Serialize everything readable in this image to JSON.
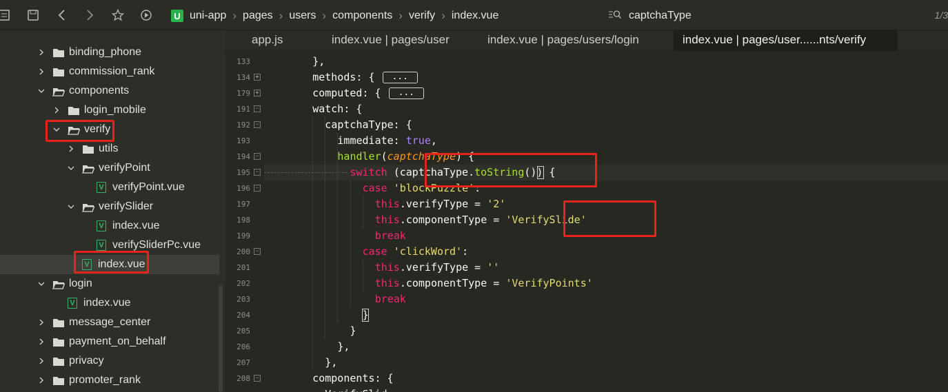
{
  "toolbar": {
    "icons": [
      "outline-icon",
      "save-icon",
      "back-icon",
      "forward-icon",
      "star-icon",
      "run-icon"
    ]
  },
  "address": {
    "logo": "U",
    "crumbs": [
      "uni-app",
      "pages",
      "users",
      "components",
      "verify",
      "index.vue"
    ]
  },
  "search": {
    "value": "captchaType"
  },
  "pager": "1/3",
  "tabs": [
    "app.js",
    "index.vue | pages/user",
    "index.vue | pages/users/login",
    "index.vue | pages/user......nts/verify"
  ],
  "tree": [
    {
      "label": "binding_phone",
      "type": "folder",
      "state": "closed"
    },
    {
      "label": "commission_rank",
      "type": "folder",
      "state": "closed"
    },
    {
      "label": "components",
      "type": "folder",
      "state": "open"
    },
    {
      "label": "login_mobile",
      "type": "folder",
      "state": "closed"
    },
    {
      "label": "verify",
      "type": "folder",
      "state": "open"
    },
    {
      "label": "utils",
      "type": "folder",
      "state": "closed"
    },
    {
      "label": "verifyPoint",
      "type": "folder",
      "state": "open"
    },
    {
      "label": "verifyPoint.vue",
      "type": "file"
    },
    {
      "label": "verifySlider",
      "type": "folder",
      "state": "open"
    },
    {
      "label": "index.vue",
      "type": "file"
    },
    {
      "label": "verifySliderPc.vue",
      "type": "file"
    },
    {
      "label": "index.vue",
      "type": "file"
    },
    {
      "label": "login",
      "type": "folder",
      "state": "open"
    },
    {
      "label": "index.vue",
      "type": "file"
    },
    {
      "label": "message_center",
      "type": "folder",
      "state": "closed"
    },
    {
      "label": "payment_on_behalf",
      "type": "folder",
      "state": "closed"
    },
    {
      "label": "privacy",
      "type": "folder",
      "state": "closed"
    },
    {
      "label": "promoter_rank",
      "type": "folder",
      "state": "closed"
    }
  ],
  "code": {
    "line_numbers": [
      "133",
      "134",
      "179",
      "191",
      "192",
      "193",
      "194",
      "195",
      "196",
      "197",
      "198",
      "199",
      "200",
      "201",
      "202",
      "203",
      "204",
      "205",
      "206",
      "207",
      "208"
    ],
    "fold_markers": [
      "",
      "+",
      "+",
      "-",
      "-",
      "",
      "-",
      "-",
      "-",
      "",
      "",
      "",
      "-",
      "",
      "",
      "",
      "",
      "",
      "",
      "",
      "-"
    ],
    "lines": [
      [
        {
          "t": "},",
          "c": "w"
        }
      ],
      [
        {
          "t": "methods: { ",
          "c": "w"
        },
        {
          "t": "...",
          "c": "fbox"
        }
      ],
      [
        {
          "t": "computed: { ",
          "c": "w"
        },
        {
          "t": "...",
          "c": "fbox"
        }
      ],
      [
        {
          "t": "watch: {",
          "c": "w"
        }
      ],
      [
        {
          "t": "captchaType: {",
          "c": "w"
        }
      ],
      [
        {
          "t": "immediate: ",
          "c": "w"
        },
        {
          "t": "true",
          "c": "p"
        },
        {
          "t": ",",
          "c": "w"
        }
      ],
      [
        {
          "t": "handler",
          "c": "f"
        },
        {
          "t": "(",
          "c": "w"
        },
        {
          "t": "captchaType",
          "c": "it"
        },
        {
          "t": ") {",
          "c": "w"
        }
      ],
      [
        {
          "t": "switch",
          "c": "k"
        },
        {
          "t": " (captchaType.",
          "c": "w"
        },
        {
          "t": "toString",
          "c": "f"
        },
        {
          "t": "()) {",
          "c": "w"
        }
      ],
      [
        {
          "t": "case",
          "c": "k"
        },
        {
          "t": " ",
          "c": "w"
        },
        {
          "t": "'blockPuzzle'",
          "c": "s"
        },
        {
          "t": ":",
          "c": "w"
        }
      ],
      [
        {
          "t": "this",
          "c": "k"
        },
        {
          "t": ".verifyType = ",
          "c": "w"
        },
        {
          "t": "'2'",
          "c": "s"
        }
      ],
      [
        {
          "t": "this",
          "c": "k"
        },
        {
          "t": ".componentType = ",
          "c": "w"
        },
        {
          "t": "'VerifySlide'",
          "c": "s"
        }
      ],
      [
        {
          "t": "break",
          "c": "k"
        }
      ],
      [
        {
          "t": "case",
          "c": "k"
        },
        {
          "t": " ",
          "c": "w"
        },
        {
          "t": "'clickWord'",
          "c": "s"
        },
        {
          "t": ":",
          "c": "w"
        }
      ],
      [
        {
          "t": "this",
          "c": "k"
        },
        {
          "t": ".verifyType = ",
          "c": "w"
        },
        {
          "t": "''",
          "c": "s"
        }
      ],
      [
        {
          "t": "this",
          "c": "k"
        },
        {
          "t": ".componentType = ",
          "c": "w"
        },
        {
          "t": "'VerifyPoints'",
          "c": "s"
        }
      ],
      [
        {
          "t": "break",
          "c": "k"
        }
      ],
      [
        {
          "t": "}",
          "c": "w"
        }
      ],
      [
        {
          "t": "}",
          "c": "w"
        }
      ],
      [
        {
          "t": "},",
          "c": "w"
        }
      ],
      [
        {
          "t": "},",
          "c": "w"
        }
      ],
      [
        {
          "t": "components: {",
          "c": "w"
        }
      ]
    ],
    "partial_last_line": "VerifySlid"
  },
  "colors": {
    "highlight": "#e8231b",
    "background": "#272822",
    "keyword": "#f92672",
    "string": "#e6db74",
    "function": "#a6e22e",
    "constant": "#ae81ff"
  }
}
